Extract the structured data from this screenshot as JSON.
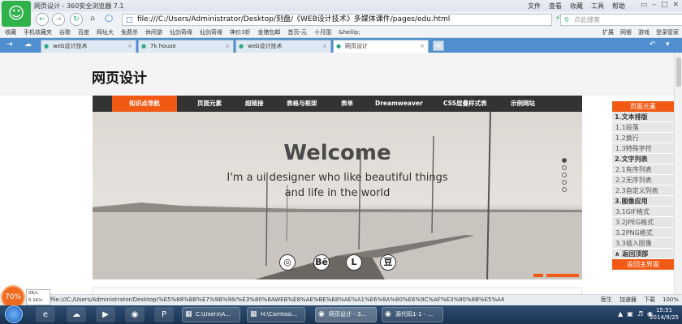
{
  "window": {
    "title": "网页设计 - 360安全浏览器 7.1",
    "menu": [
      "文件",
      "查看",
      "收藏",
      "工具",
      "帮助"
    ],
    "controls": [
      "▭",
      "–",
      "□",
      "✕"
    ]
  },
  "navbar": {
    "url": "file:///C:/Users/Administrator/Desktop/刻盘/《WEB设计技术》多媒体课件/pages/edu.html",
    "search_placeholder": "点此搜索"
  },
  "bookmarks": {
    "items": [
      "收藏",
      "手机收藏夹",
      "谷歌",
      "百度",
      "网址大",
      "免费杀",
      "休闲游",
      "仙剑奇缘",
      "仙剑奇缘",
      "神价3折",
      "金猪包邮",
      "首页-元",
      "十月围",
      "&hellip;"
    ],
    "right": [
      "扩展",
      "网银",
      "游戏",
      "登录管家"
    ]
  },
  "tabs": [
    {
      "label": "web设计技术",
      "active": false
    },
    {
      "label": "7k house",
      "active": false
    },
    {
      "label": "web设计技术",
      "active": false
    },
    {
      "label": "网页设计",
      "active": true
    }
  ],
  "page": {
    "title": "网页设计",
    "nav": [
      {
        "label": "知识点导航",
        "active": true
      },
      {
        "label": "页面元素",
        "active": false
      },
      {
        "label": "超链接",
        "active": false
      },
      {
        "label": "表格与框架",
        "active": false
      },
      {
        "label": "表单",
        "active": false
      },
      {
        "label": "Dreamweaver",
        "active": false
      },
      {
        "label": "CSS层叠样式表",
        "active": false
      },
      {
        "label": "示例网站",
        "active": false
      }
    ],
    "hero": {
      "heading": "Welcome",
      "line1": "I'm a ui designer who like beautiful things",
      "line2": "and life in the world",
      "social": [
        "◎",
        "Bē",
        "L",
        "豆"
      ]
    }
  },
  "sidebar": {
    "head": "页面元素",
    "rows": [
      {
        "label": "1.文本排版",
        "kind": "cat"
      },
      {
        "label": "1.1段落",
        "kind": "sub"
      },
      {
        "label": "1.2换行",
        "kind": "sub"
      },
      {
        "label": "1.3特殊字符",
        "kind": "sub"
      },
      {
        "label": "2.文字列表",
        "kind": "cat"
      },
      {
        "label": "2.1有序列表",
        "kind": "sub"
      },
      {
        "label": "2.2无序列表",
        "kind": "sub"
      },
      {
        "label": "2.3自定义列表",
        "kind": "sub"
      },
      {
        "label": "3.图像应用",
        "kind": "cat"
      },
      {
        "label": "3.1GIF格式",
        "kind": "sub"
      },
      {
        "label": "3.2JPEG格式",
        "kind": "sub"
      },
      {
        "label": "3.2PNG格式",
        "kind": "sub"
      },
      {
        "label": "3.3插入图像",
        "kind": "sub"
      }
    ],
    "back_top": "返回顶部",
    "back_home": "返回主界面"
  },
  "status": {
    "speed_percent": "70%",
    "up": "0K/s",
    "down": "0.1K/s",
    "url": "file:///C:/Users/Administrator/Desktop/%E5%88%BB%E7%9B%98/%E3%80%8AWEB%E8%AE%BE%E8%AE%A1%E6%8A%80%E6%9C%AF%E3%80%8B%E5%A4",
    "right": [
      "医生",
      "加速器",
      "下载",
      "100%"
    ]
  },
  "taskbar": {
    "buttons": [
      "C:\\Users\\A...",
      "H:\\Camtasi...",
      "网页设计 - 3...",
      "源代码1-1 - ..."
    ],
    "time": "15:51",
    "date": "2014/9/25"
  },
  "colors": {
    "accent": "#f05a14",
    "nav_bg": "#333333",
    "tabstrip": "#4f8fd0"
  }
}
